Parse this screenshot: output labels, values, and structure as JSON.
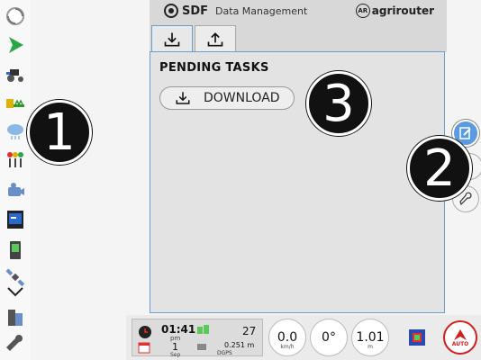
{
  "header": {
    "brand": "SDF",
    "app_title": "Data Management",
    "partner": "agrirouter",
    "partner_mark": "AR"
  },
  "tabs": [
    {
      "icon": "download-icon",
      "active": true
    },
    {
      "icon": "upload-icon",
      "active": false
    }
  ],
  "content": {
    "section_title": "PENDING TASKS",
    "download_label": "DOWNLOAD"
  },
  "callouts": [
    "1",
    "2",
    "3"
  ],
  "status": {
    "time": "01:41",
    "ampm": "pm",
    "day": "1",
    "month": "Sep",
    "satellites": "27",
    "accuracy": "0.251",
    "accuracy_unit": "m",
    "gps_mode": "DGPS",
    "speed": "0.0",
    "speed_unit": "km/h",
    "heading": "0°",
    "offset": "1.01",
    "offset_unit": "m",
    "auto_label": "AUTO"
  },
  "colors": {
    "accent": "#6a9ecf",
    "auto_red": "#d02020"
  }
}
